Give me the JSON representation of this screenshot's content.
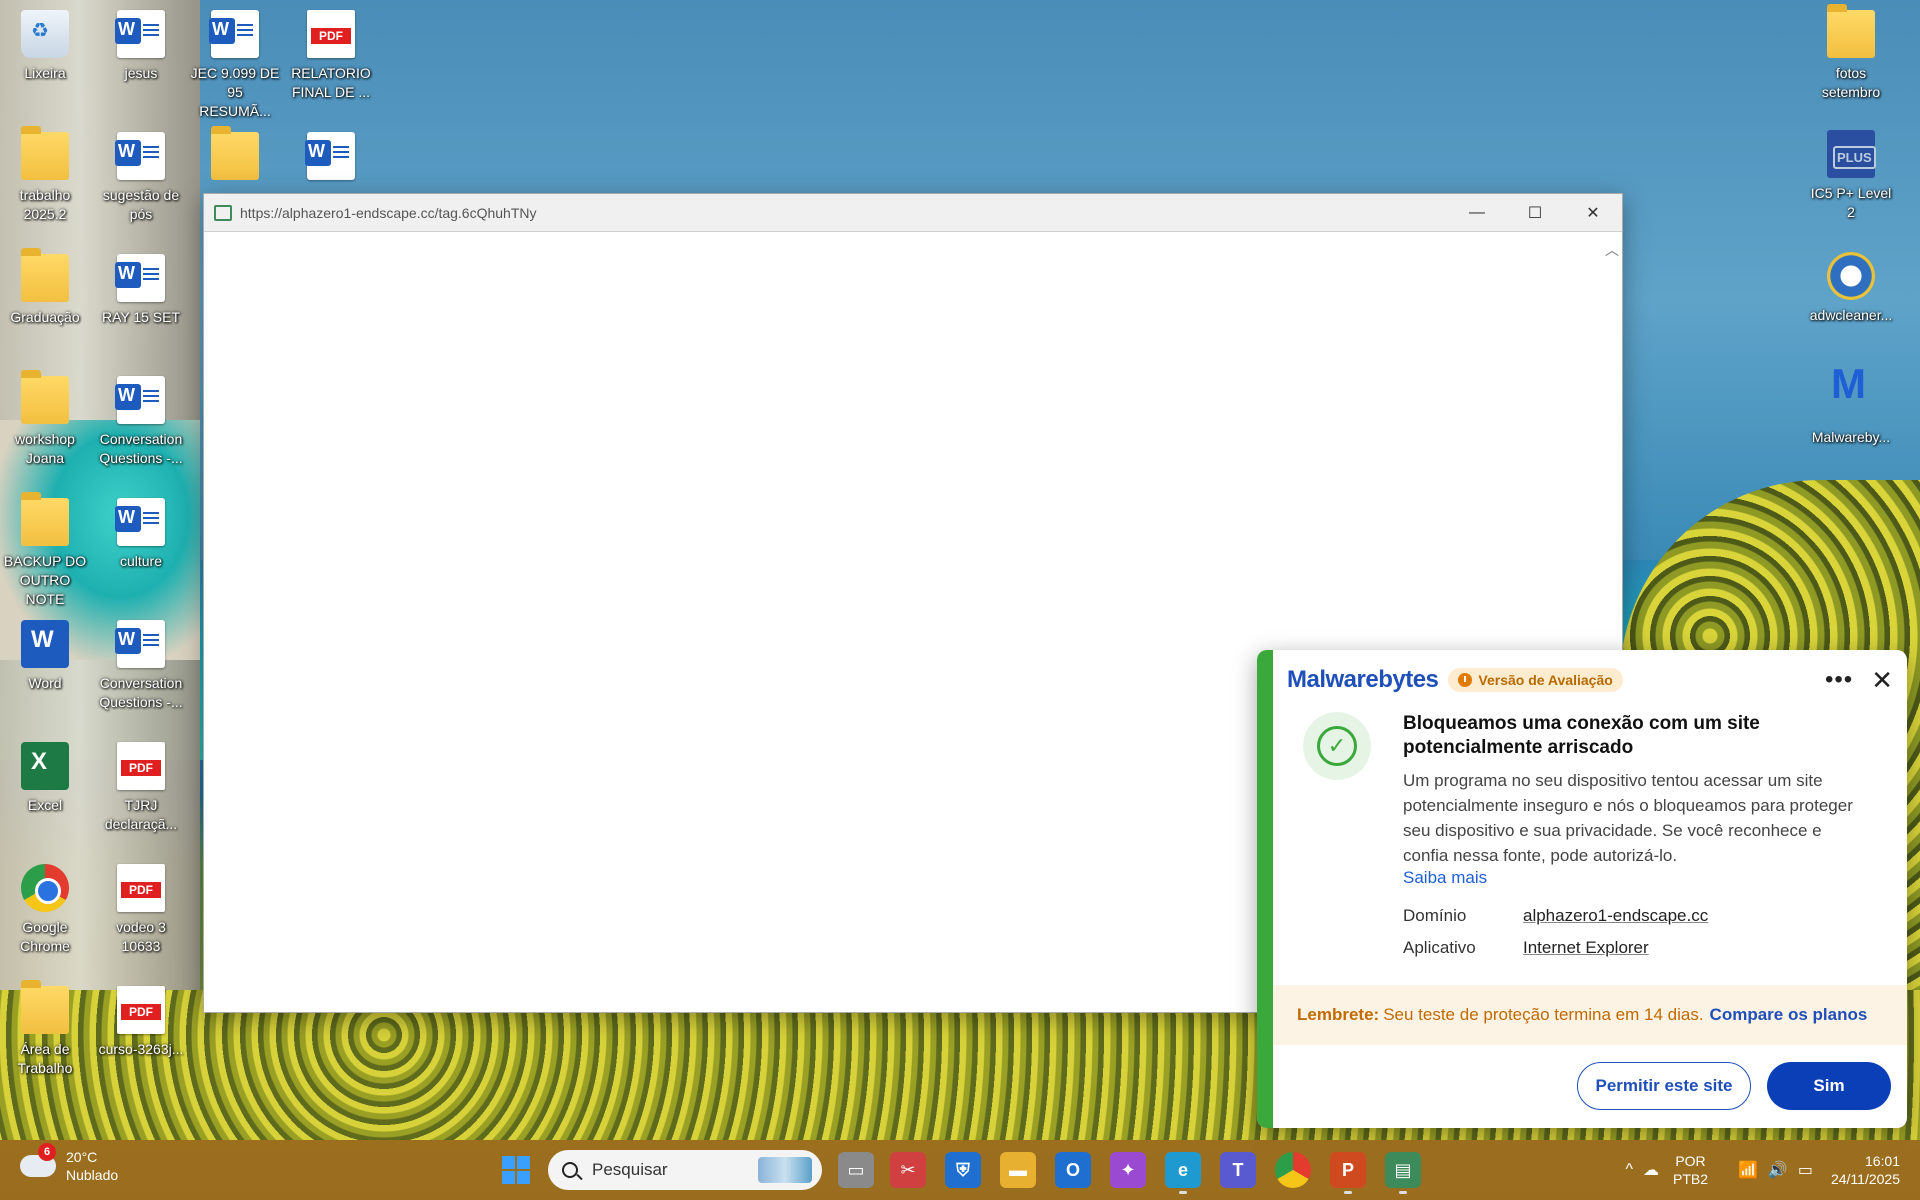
{
  "desktop": {
    "icons_left": [
      {
        "label": "Lixeira",
        "icon": "recycle-bin-icon"
      },
      {
        "label": "jesus",
        "icon": "word-doc-icon"
      },
      {
        "label": "JEC 9.099 DE 95 RESUMÃ...",
        "icon": "word-doc-icon"
      },
      {
        "label": "RELATORIO FINAL DE ...",
        "icon": "pdf-icon"
      },
      {
        "label": "trabalho 2025.2",
        "icon": "folder-icon"
      },
      {
        "label": "sugestão de pós",
        "icon": "word-doc-icon"
      },
      {
        "label": "Graduação",
        "icon": "folder-icon"
      },
      {
        "label": "RAY 15 SET",
        "icon": "word-doc-icon"
      },
      {
        "label": "workshop Joana",
        "icon": "folder-icon"
      },
      {
        "label": "Conversation Questions -...",
        "icon": "word-doc-icon"
      },
      {
        "label": "BACKUP DO OUTRO NOTE",
        "icon": "folder-icon"
      },
      {
        "label": "culture",
        "icon": "word-doc-icon"
      },
      {
        "label": "Word",
        "icon": "word-app-icon"
      },
      {
        "label": "Conversation Questions -...",
        "icon": "word-doc-icon"
      },
      {
        "label": "Excel",
        "icon": "excel-app-icon"
      },
      {
        "label": "TJRJ declaraçã...",
        "icon": "pdf-icon"
      },
      {
        "label": "Google Chrome",
        "icon": "chrome-icon"
      },
      {
        "label": "vodeo 3 10633",
        "icon": "pdf-icon"
      },
      {
        "label": "Área de Trabalho",
        "icon": "folder-icon"
      },
      {
        "label": "curso-3263j...",
        "icon": "pdf-icon"
      }
    ],
    "icons_right": [
      {
        "label": "fotos setembro",
        "icon": "folder-icon"
      },
      {
        "label": "IC5 P+ Level 2",
        "icon": "plus-app-icon"
      },
      {
        "label": "adwcleaner...",
        "icon": "adwcleaner-icon"
      },
      {
        "label": "Malwareby...",
        "icon": "malwarebytes-icon"
      }
    ],
    "pdf_label": "PDF",
    "word_letter": "W",
    "excel_letter": "X"
  },
  "browser": {
    "url": "https://alphazero1-endscape.cc/tag.6cQhuhTNy",
    "minimize": "—",
    "maximize": "☐",
    "close": "✕",
    "scroll_up": "︿"
  },
  "malwarebytes": {
    "brand": "Malwarebytes",
    "badge": "Versão de Avaliação",
    "more": "•••",
    "close": "✕",
    "check": "✓",
    "title": "Bloqueamos uma conexão com um site potencialmente arriscado",
    "description": "Um programa no seu dispositivo tentou acessar um site potencialmente inseguro e nós o bloqueamos para proteger seu dispositivo e sua privacidade. Se você reconhece e confia nessa fonte, pode autorizá-lo.",
    "learn_more": "Saiba mais",
    "domain_label": "Domínio",
    "domain_value": "alphazero1-endscape.cc",
    "app_label": "Aplicativo",
    "app_value": "Internet Explorer",
    "reminder_label": "Lembrete:",
    "reminder_text": "Seu teste de proteção termina em 14 dias.",
    "reminder_link": "Compare os planos",
    "allow_button": "Permitir este site",
    "yes_button": "Sim",
    "colors": {
      "accent": "#0b3fb8",
      "stripe": "#3aa83a",
      "reminder": "#c06a00"
    }
  },
  "taskbar": {
    "weather_badge": "6",
    "weather_temp": "20°C",
    "weather_condition": "Nublado",
    "search_placeholder": "Pesquisar",
    "apps": [
      "file-manager-icon",
      "snipping-tool-icon",
      "defender-icon",
      "file-explorer-icon",
      "outlook-icon",
      "copilot-icon",
      "edge-icon",
      "teams-icon",
      "chrome-icon",
      "powerpoint-icon",
      "internet-explorer-icon"
    ],
    "tray_chevron": "^",
    "lang_top": "POR",
    "lang_bottom": "PTB2",
    "time": "16:01",
    "date": "24/11/2025"
  }
}
